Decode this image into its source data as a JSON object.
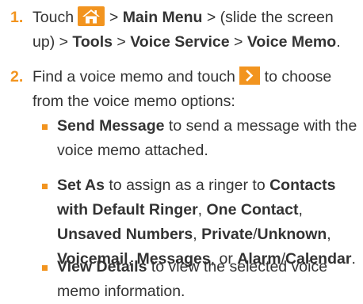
{
  "steps": [
    {
      "number": "1.",
      "parts": {
        "a": "Touch ",
        "home_icon": "home-icon",
        "b": " > ",
        "main_menu": "Main Menu",
        "c": " > (slide the screen up) > ",
        "tools": "Tools",
        "d": " > ",
        "voice_service": "Voice Service",
        "e": " > ",
        "voice_memo": "Voice Memo",
        "f": "."
      }
    },
    {
      "number": "2.",
      "parts": {
        "a": "Find a voice memo and touch ",
        "chevron_icon": "chevron-right-icon",
        "b": " to choose from the voice memo options:"
      }
    }
  ],
  "options": [
    {
      "bold": "Send Message",
      "text": " to send a message with the voice memo attached."
    },
    {
      "bold": "Set As",
      "t1": " to assign as a ringer to ",
      "b2": "Contacts with Default Ringer",
      "t2": ", ",
      "b3": "One Contact",
      "t3": ", ",
      "b4": "Unsaved Numbers",
      "t4": ", ",
      "b5": "Private",
      "t5": "/",
      "b6": "Unknown",
      "t6": ", ",
      "b7": "Voicemail",
      "t7": ", ",
      "b8": "Messages",
      "t8": ", or ",
      "b9": "Alarm",
      "t9": "/",
      "b10": "Calendar",
      "t10": "."
    },
    {
      "bold": "View Details",
      "text": " to view the selected voice memo information."
    }
  ],
  "colors": {
    "accent": "#f2941f",
    "text": "#333333"
  }
}
